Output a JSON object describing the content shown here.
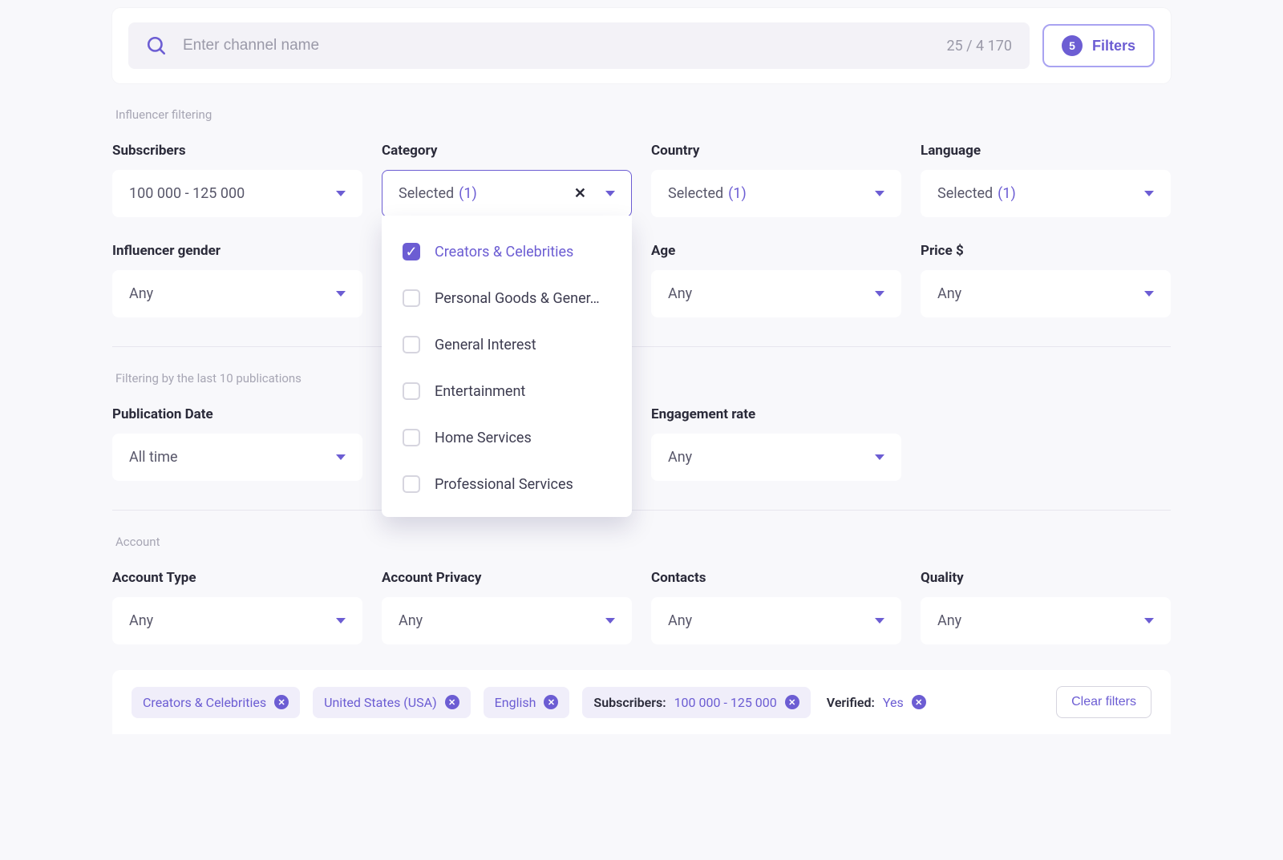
{
  "search": {
    "placeholder": "Enter channel name",
    "count": "25 / 4 170"
  },
  "filtersButton": {
    "count": "5",
    "label": "Filters"
  },
  "sections": {
    "influencer": "Influencer filtering",
    "publications": "Filtering by the last 10 publications",
    "account": "Account"
  },
  "filters": {
    "subscribers": {
      "label": "Subscribers",
      "value": "100 000 - 125 000"
    },
    "category": {
      "label": "Category",
      "value": "Selected",
      "count": "(1)"
    },
    "country": {
      "label": "Country",
      "value": "Selected",
      "count": "(1)"
    },
    "language": {
      "label": "Language",
      "value": "Selected",
      "count": "(1)"
    },
    "influencer_gender": {
      "label": "Influencer gender",
      "value": "Any"
    },
    "age": {
      "label": "Age",
      "value": "Any"
    },
    "price": {
      "label": "Price $",
      "value": "Any"
    },
    "publication_date": {
      "label": "Publication Date",
      "value": "All time"
    },
    "engagement_rate": {
      "label": "Engagement rate",
      "value": "Any"
    },
    "account_type": {
      "label": "Account Type",
      "value": "Any"
    },
    "account_privacy": {
      "label": "Account Privacy",
      "value": "Any"
    },
    "contacts": {
      "label": "Contacts",
      "value": "Any"
    },
    "quality": {
      "label": "Quality",
      "value": "Any"
    }
  },
  "categoryOptions": [
    {
      "label": "Creators & Celebrities",
      "checked": true
    },
    {
      "label": "Personal Goods & Gener…",
      "checked": false
    },
    {
      "label": "General Interest",
      "checked": false
    },
    {
      "label": "Entertainment",
      "checked": false
    },
    {
      "label": "Home Services",
      "checked": false
    },
    {
      "label": "Professional Services",
      "checked": false
    }
  ],
  "chips": {
    "category": {
      "label": "Creators & Celebrities"
    },
    "country": {
      "label": "United States (USA)"
    },
    "language": {
      "label": "English"
    },
    "subscribers": {
      "key": "Subscribers:",
      "value": "100 000 - 125 000"
    },
    "verified": {
      "key": "Verified:",
      "value": "Yes"
    },
    "clear": "Clear filters"
  }
}
